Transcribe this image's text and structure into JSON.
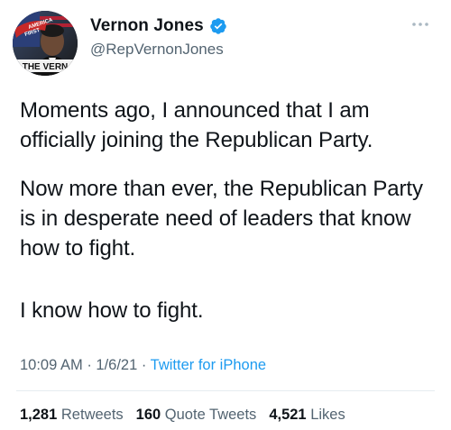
{
  "user": {
    "display_name": "Vernon Jones",
    "handle": "@RepVernonJones",
    "verified": true,
    "avatar_lettering": [
      "AMERICA",
      "FIRST",
      "THE VERN"
    ]
  },
  "tweet": {
    "paragraphs": [
      "Moments ago, I announced that I am officially joining the Republican Party.",
      "Now more than ever, the Republican Party is in desperate need of leaders that know how to fight.",
      "I know how to fight."
    ],
    "time": "10:09 AM",
    "separator": "·",
    "date": "1/6/21",
    "source": "Twitter for iPhone"
  },
  "stats": {
    "retweets_count": "1,281",
    "retweets_label": "Retweets",
    "quotes_count": "160",
    "quotes_label": "Quote Tweets",
    "likes_count": "4,521",
    "likes_label": "Likes"
  },
  "colors": {
    "verified_blue": "#1d9bf0",
    "link_blue": "#1d9bf0",
    "secondary_text": "#536471",
    "primary_text": "#0f1419"
  },
  "icons": {
    "verified": "verified-badge-icon",
    "more": "more-options-icon"
  }
}
